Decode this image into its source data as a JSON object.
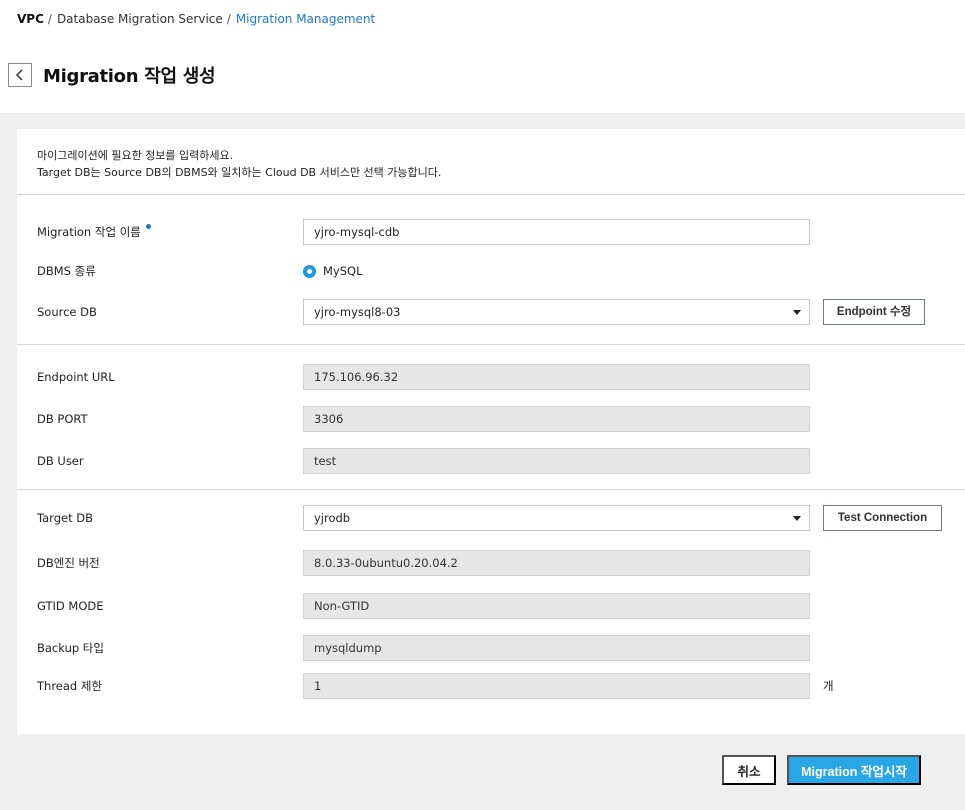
{
  "breadcrumb": {
    "root": "VPC",
    "separator": "/",
    "service": "Database Migration Service",
    "current": "Migration Management"
  },
  "header": {
    "back_icon": "chevron-left-icon",
    "title": "Migration 작업 생성"
  },
  "notice": {
    "line1": "마이그레이션에 필요한 정보를 입력하세요.",
    "line2": "Target DB는 Source DB의 DBMS와 일치하는 Cloud DB 서비스만 선택 가능합니다."
  },
  "form": {
    "task_name": {
      "label": "Migration 작업 이름",
      "value": "yjro-mysql-cdb",
      "required": true
    },
    "dbms_type": {
      "label": "DBMS 종류",
      "option": "MySQL",
      "selected": true
    },
    "source_db": {
      "label": "Source DB",
      "value": "yjro-mysql8-03",
      "button": "Endpoint 수정"
    },
    "endpoint_url": {
      "label": "Endpoint URL",
      "value": "175.106.96.32"
    },
    "db_port": {
      "label": "DB PORT",
      "value": "3306"
    },
    "db_user": {
      "label": "DB User",
      "value": "test"
    },
    "target_db": {
      "label": "Target DB",
      "value": "yjrodb",
      "button": "Test Connection"
    },
    "engine_version": {
      "label": "DB엔진 버전",
      "value": "8.0.33-0ubuntu0.20.04.2"
    },
    "gtid_mode": {
      "label": "GTID MODE",
      "value": "Non-GTID"
    },
    "backup_type": {
      "label": "Backup 타입",
      "value": "mysqldump"
    },
    "thread_limit": {
      "label": "Thread 제한",
      "value": "1",
      "unit": "개"
    }
  },
  "footer": {
    "cancel": "취소",
    "start": "Migration 작업시작"
  },
  "colors": {
    "accent": "#29a6e6",
    "link": "#1e78c8",
    "background_gray": "#efefef",
    "readonly_field": "#e6e6e6"
  }
}
